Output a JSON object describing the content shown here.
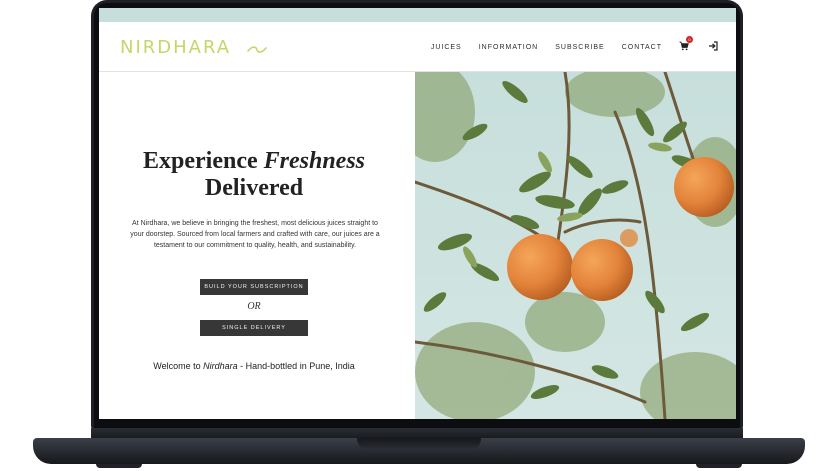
{
  "brand": {
    "name": "NIRDHARA",
    "logo_color": "#c6d66a"
  },
  "nav": {
    "items": [
      "JUICES",
      "INFORMATION",
      "SUBSCRIBE",
      "CONTACT"
    ],
    "cart_count": "0"
  },
  "hero": {
    "title_part1": "Experience",
    "title_emphasis": "Freshness",
    "title_line2": "Delivered",
    "description": "At Nirdhara, we believe in bringing the freshest, most delicious juices straight to your doorstep. Sourced from local farmers and crafted with care, our juices are a testament to our commitment to quality, health, and sustainability.",
    "subscription_button": "BUILD YOUR SUBSCRIPTION",
    "or_label": "OR",
    "single_button": "SINGLE DELIVERY",
    "welcome_prefix": "Welcome to",
    "welcome_brand": "Nirdhara",
    "welcome_suffix": "- Hand-bottled in Pune, India"
  },
  "colors": {
    "top_band": "#c8dedc",
    "button_bg": "#373737",
    "sky": "#c9e1df",
    "orange": "#e58a3c"
  }
}
